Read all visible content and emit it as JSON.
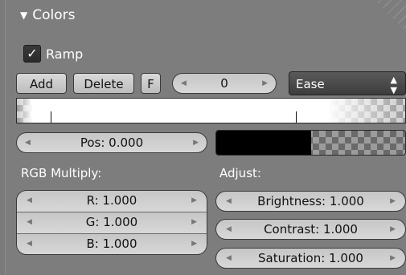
{
  "panel": {
    "title": "Colors"
  },
  "ramp": {
    "label": "Ramp",
    "checked": true
  },
  "toolbar": {
    "add_label": "Add",
    "delete_label": "Delete",
    "flip_label": "F",
    "index_value": "0",
    "interpolation": "Ease"
  },
  "position": {
    "label": "Pos: 0.000"
  },
  "rgb_multiply": {
    "heading": "RGB Multiply:",
    "r": "R: 1.000",
    "g": "G: 1.000",
    "b": "B: 1.000"
  },
  "adjust": {
    "heading": "Adjust:",
    "brightness": "Brightness: 1.000",
    "contrast": "Contrast: 1.000",
    "saturation": "Saturation: 1.000"
  },
  "colors": {
    "swatch": "#000000",
    "panel_bg": "#7d7d7d"
  }
}
